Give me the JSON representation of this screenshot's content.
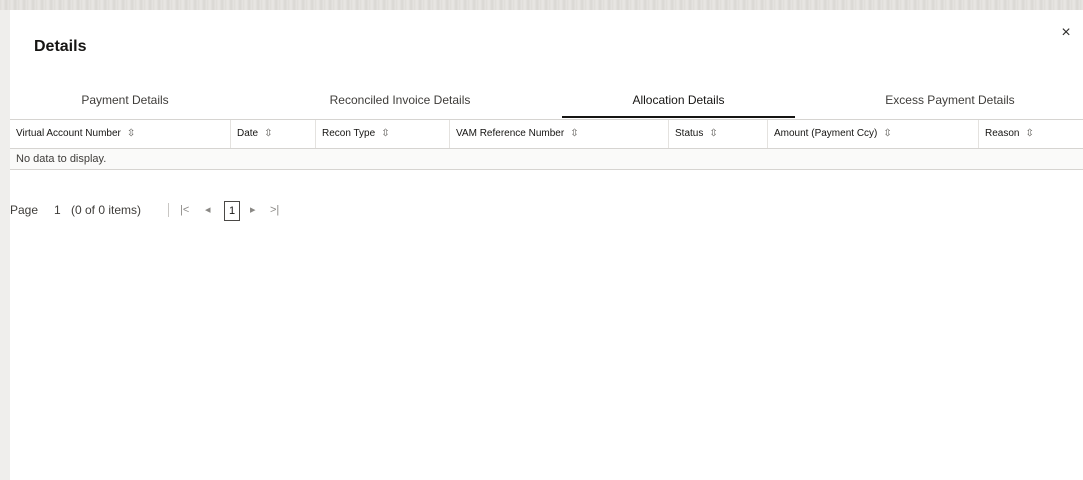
{
  "dialog": {
    "title": "Details",
    "close_glyph": "×"
  },
  "tabs": [
    {
      "label": "Payment Details",
      "active": false
    },
    {
      "label": "Reconciled Invoice Details",
      "active": false
    },
    {
      "label": "Allocation Details",
      "active": true
    },
    {
      "label": "Excess Payment Details",
      "active": false
    }
  ],
  "table": {
    "columns": [
      "Virtual Account Number",
      "Date",
      "Recon Type",
      "VAM Reference Number",
      "Status",
      "Amount (Payment Ccy)",
      "Reason"
    ],
    "sort_icon": "⇳",
    "empty_message": "No data to display."
  },
  "pagination": {
    "page_label": "Page",
    "page_value": "1",
    "items_summary": "(0 of 0 items)",
    "first_glyph": "|<",
    "prev_glyph": "◂",
    "current_page": "1",
    "next_glyph": "▸",
    "last_glyph": ">|"
  }
}
